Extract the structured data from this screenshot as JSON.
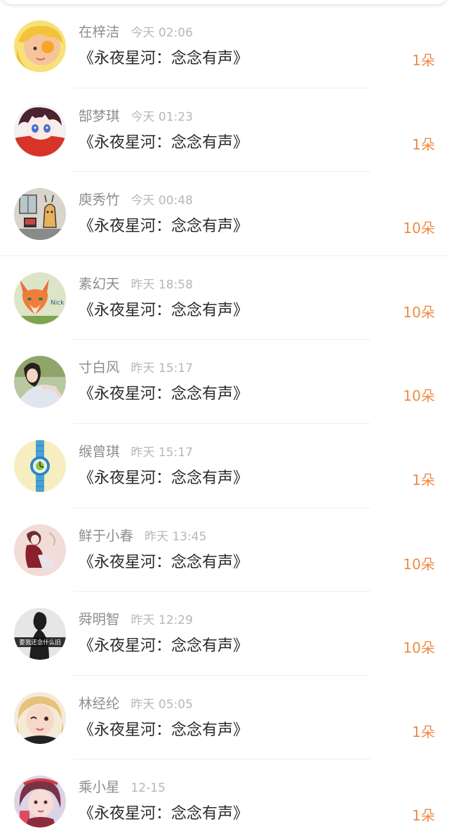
{
  "gift_list": {
    "rows": [
      {
        "name": "在梓洁",
        "time": "今天 02:06",
        "title": "《永夜星河：念念有声》",
        "count": "1朵"
      },
      {
        "name": "郜梦琪",
        "time": "今天 01:23",
        "title": "《永夜星河：念念有声》",
        "count": "1朵"
      },
      {
        "name": "庾秀竹",
        "time": "今天 00:48",
        "title": "《永夜星河：念念有声》",
        "count": "10朵"
      },
      {
        "name": "素幻天",
        "time": "昨天 18:58",
        "title": "《永夜星河：念念有声》",
        "count": "10朵"
      },
      {
        "name": "寸白风",
        "time": "昨天 15:17",
        "title": "《永夜星河：念念有声》",
        "count": "10朵"
      },
      {
        "name": "缑曾琪",
        "time": "昨天 15:17",
        "title": "《永夜星河：念念有声》",
        "count": "1朵"
      },
      {
        "name": "鲜于小春",
        "time": "昨天 13:45",
        "title": "《永夜星河：念念有声》",
        "count": "10朵"
      },
      {
        "name": "舜明智",
        "time": "昨天 12:29",
        "title": "《永夜星河：念念有声》",
        "count": "10朵"
      },
      {
        "name": "林经纶",
        "time": "昨天 05:05",
        "title": "《永夜星河：念念有声》",
        "count": "1朵"
      },
      {
        "name": "乘小星",
        "time": "12-15",
        "title": "《永夜星河：念念有声》",
        "count": "1朵"
      }
    ],
    "avatar_8_caption": "要我还念什么旧",
    "avatar_4_caption": "Nick Wi"
  },
  "colors": {
    "name": "#8e8e8e",
    "time": "#b7b7b7",
    "title": "#2a2a2a",
    "count_accent": "#ef8a45",
    "divider": "#efefef"
  }
}
